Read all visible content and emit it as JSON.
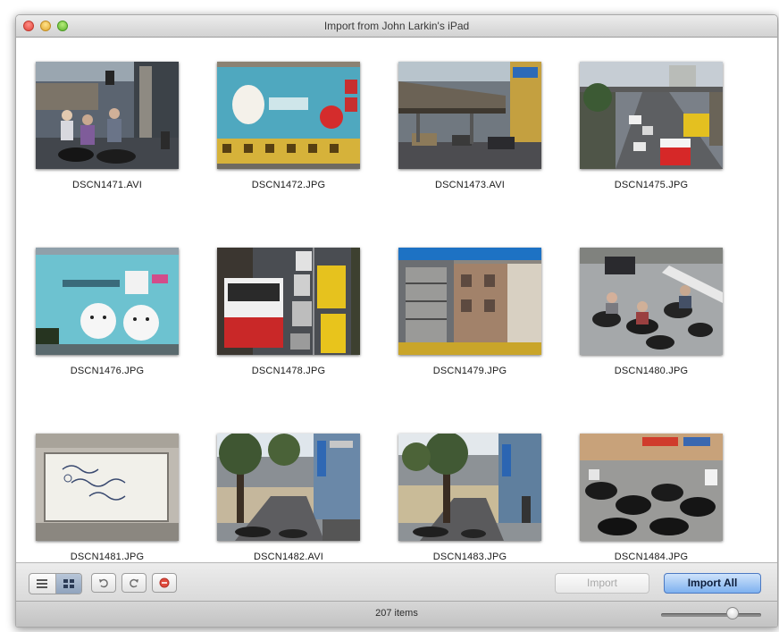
{
  "window": {
    "title": "Import from John Larkin's iPad"
  },
  "photos": [
    {
      "filename": "DSCN1471.AVI",
      "scene": "street-scooters"
    },
    {
      "filename": "DSCN1472.JPG",
      "scene": "teal-sign"
    },
    {
      "filename": "DSCN1473.AVI",
      "scene": "overpass"
    },
    {
      "filename": "DSCN1475.JPG",
      "scene": "traffic-bus"
    },
    {
      "filename": "DSCN1476.JPG",
      "scene": "mural-bears"
    },
    {
      "filename": "DSCN1478.JPG",
      "scene": "aerial-bus"
    },
    {
      "filename": "DSCN1479.JPG",
      "scene": "building"
    },
    {
      "filename": "DSCN1480.JPG",
      "scene": "scooter-crowd"
    },
    {
      "filename": "DSCN1481.JPG",
      "scene": "whiteboard"
    },
    {
      "filename": "DSCN1482.AVI",
      "scene": "tree-street"
    },
    {
      "filename": "DSCN1483.JPG",
      "scene": "tree-street-2"
    },
    {
      "filename": "DSCN1484.JPG",
      "scene": "parked-scooters"
    }
  ],
  "toolbar": {
    "view_mode_selected": "grid",
    "view_icons": [
      "list-view-icon",
      "grid-view-icon"
    ],
    "action_icons": [
      "rotate-left-icon",
      "rotate-right-icon",
      "delete-icon"
    ],
    "import_label": "Import",
    "import_all_label": "Import All"
  },
  "status": {
    "item_count": "207 items",
    "thumbnail_size_level": 0.8
  },
  "colors": {
    "accent": "#5b8fd9",
    "close": "#e0443a",
    "minimize": "#e1a730",
    "zoom": "#5eb32e",
    "delete": "#e04b3e"
  }
}
